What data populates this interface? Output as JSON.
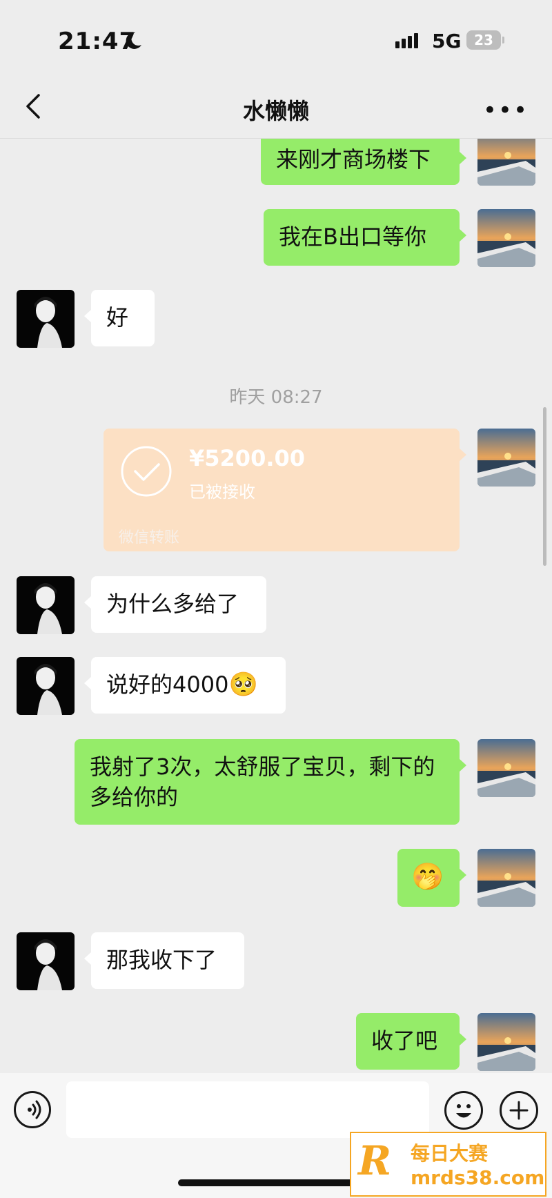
{
  "status": {
    "time": "21:47",
    "network": "5G",
    "battery": "23"
  },
  "header": {
    "title": "水懒懒"
  },
  "messages": {
    "m1": "来刚才商场楼下",
    "m2": "我在B出口等你",
    "m3": "好",
    "timestamp": "昨天 08:27",
    "transfer": {
      "amount": "¥5200.00",
      "status": "已被接收",
      "label": "微信转账"
    },
    "m4": "为什么多给了",
    "m5": "说好的4000",
    "m5_emoji": "🥺",
    "m6": "我射了3次，太舒服了宝贝，剩下的多给你的",
    "m7_emoji": "🤭",
    "m8": "那我收下了",
    "m9": "收了吧"
  },
  "watermark": {
    "brand": "每日大赛",
    "url": "mrds38.com",
    "logo": "R"
  }
}
